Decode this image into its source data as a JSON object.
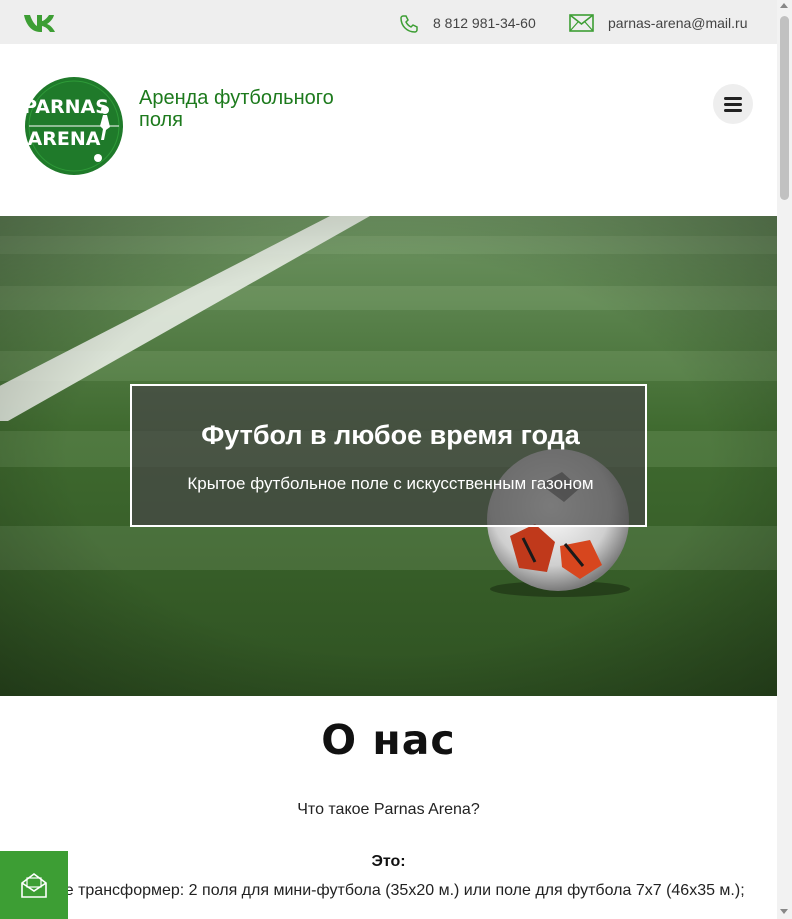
{
  "topbar": {
    "social_icon": "vk-icon",
    "phone_icon": "phone-icon",
    "phone": "8 812 981-34-60",
    "mail_icon": "envelope-icon",
    "email": "parnas-arena@mail.ru"
  },
  "header": {
    "logo_text_line1": "PARNAS",
    "logo_text_line2": "ARENA",
    "site_title": "Аренда футбольного поля",
    "menu_icon": "hamburger-menu-icon"
  },
  "hero": {
    "title": "Футбол в любое время года",
    "subtitle": "Крытое футбольное поле с искусственным газоном"
  },
  "about": {
    "heading": "О нас",
    "question": "Что такое Parnas Arena?",
    "this_label": "Это:",
    "line1": "Поле трансформер: 2 поля для мини-футбола (35х20 м.) или поле для футбола 7х7 (46х35 м.);"
  },
  "floating": {
    "icon": "envelope-open-icon"
  },
  "colors": {
    "brand_green": "#1d7a1d",
    "button_green": "#3d9e34",
    "topbar": "#eeeeee"
  }
}
